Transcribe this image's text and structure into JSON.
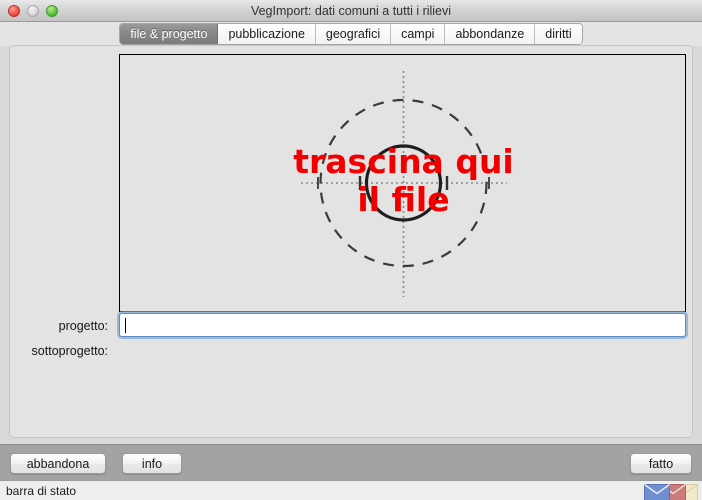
{
  "window": {
    "title": "VegImport: dati comuni a tutti i rilievi",
    "controls": [
      {
        "name": "close-button",
        "label": "close"
      },
      {
        "name": "minimize-button",
        "label": "minimize"
      },
      {
        "name": "zoom-button",
        "label": "zoom"
      }
    ]
  },
  "tabs": [
    {
      "label": "file & progetto",
      "selected": true
    },
    {
      "label": "pubblicazione",
      "selected": false
    },
    {
      "label": "geografici",
      "selected": false
    },
    {
      "label": "campi",
      "selected": false
    },
    {
      "label": "abbondanze",
      "selected": false
    },
    {
      "label": "diritti",
      "selected": false
    }
  ],
  "dropzone": {
    "line1": "trascina qui",
    "line2": "il file",
    "text_color": "#f20000",
    "icon": "crosshair-target-icon"
  },
  "form": {
    "progetto": {
      "label": "progetto:",
      "value": "",
      "placeholder": "",
      "focused": true
    },
    "sottoprogetto": {
      "label": "sottoprogetto:"
    }
  },
  "buttons": {
    "abbandona": "abbandona",
    "info": "info",
    "fatto": "fatto"
  },
  "statusbar": {
    "text": "barra di stato",
    "icons": [
      {
        "name": "envelope-blue-icon",
        "color": "#6f8fd0"
      },
      {
        "name": "envelope-red-icon",
        "color": "#cc7a7a"
      },
      {
        "name": "envelope-yellow-icon",
        "color": "#f2e9c8"
      }
    ]
  },
  "colors": {
    "accent_focus": "#5d8ec4",
    "window_bg": "#e3e3e3",
    "buttonbar_bg": "#a3a3a3"
  }
}
